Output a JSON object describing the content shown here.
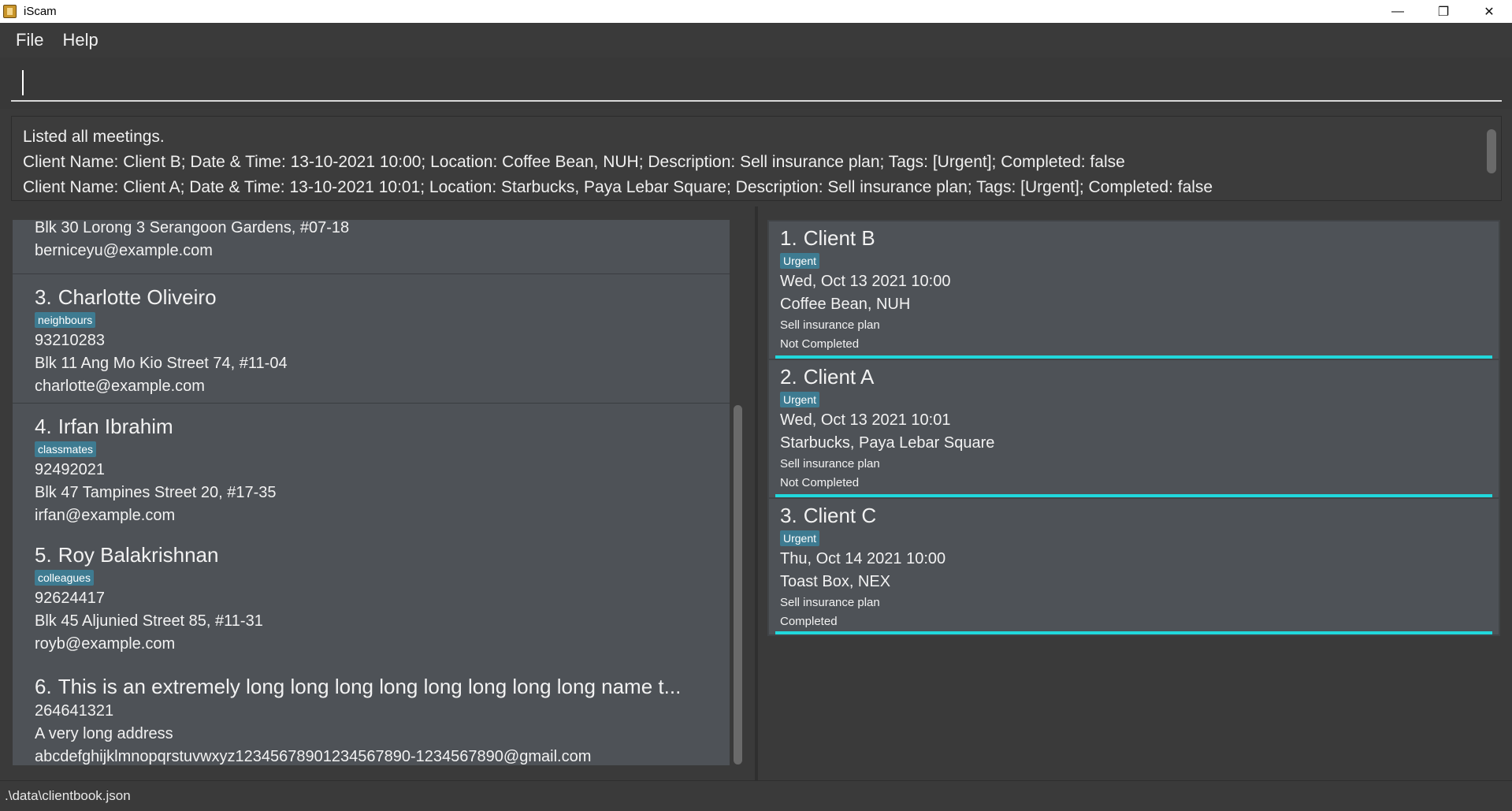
{
  "window": {
    "title": "iScam",
    "controls": {
      "minimize": "—",
      "maximize": "❐",
      "close": "✕"
    }
  },
  "menu": {
    "items": [
      "File",
      "Help"
    ]
  },
  "command": {
    "value": "",
    "placeholder": ""
  },
  "result": {
    "lines": [
      "Listed all meetings.",
      "Client Name: Client B; Date & Time: 13-10-2021 10:00; Location: Coffee Bean, NUH; Description: Sell insurance plan; Tags: [Urgent]; Completed: false",
      "Client Name: Client A; Date & Time: 13-10-2021 10:01; Location: Starbucks, Paya Lebar Square; Description: Sell insurance plan; Tags: [Urgent]; Completed: false"
    ]
  },
  "clients": [
    {
      "index": "",
      "name": "",
      "tags": [],
      "phone": "",
      "address": "Blk 30 Lorong 3 Serangoon Gardens, #07-18",
      "email": "berniceyu@example.com"
    },
    {
      "index": "3.",
      "name": "Charlotte Oliveiro",
      "tags": [
        "neighbours"
      ],
      "phone": "93210283",
      "address": "Blk 11 Ang Mo Kio Street 74, #11-04",
      "email": "charlotte@example.com"
    },
    {
      "index": "4.",
      "name": "Irfan Ibrahim",
      "tags": [
        "classmates"
      ],
      "phone": "92492021",
      "address": "Blk 47 Tampines Street 20, #17-35",
      "email": "irfan@example.com"
    },
    {
      "index": "5.",
      "name": "Roy Balakrishnan",
      "tags": [
        "colleagues"
      ],
      "phone": "92624417",
      "address": "Blk 45 Aljunied Street 85, #11-31",
      "email": "royb@example.com"
    },
    {
      "index": "6.",
      "name": "This is an extremely long long long long long long long long name t...",
      "tags": [],
      "phone": "264641321",
      "address": "A very long address",
      "email": "abcdefghijklmnopqrstuvwxyz12345678901234567890-1234567890@gmail.com"
    }
  ],
  "meetings": [
    {
      "index": "1.",
      "name": "Client B",
      "tag": "Urgent",
      "datetime": "Wed, Oct 13 2021 10:00",
      "location": "Coffee Bean, NUH",
      "description": "Sell insurance plan",
      "status": "Not Completed"
    },
    {
      "index": "2.",
      "name": "Client A",
      "tag": "Urgent",
      "datetime": "Wed, Oct 13 2021 10:01",
      "location": "Starbucks, Paya Lebar Square",
      "description": "Sell insurance plan",
      "status": "Not Completed"
    },
    {
      "index": "3.",
      "name": "Client C",
      "tag": "Urgent",
      "datetime": "Thu, Oct 14 2021 10:00",
      "location": "Toast Box, NEX",
      "description": "Sell insurance plan",
      "status": "Completed"
    }
  ],
  "status": {
    "file_path": ".\\data\\clientbook.json"
  },
  "colors": {
    "accent": "#21d8dc",
    "tag": "#3e7b91",
    "card": "#4e5257",
    "background": "#3a3a3a"
  }
}
